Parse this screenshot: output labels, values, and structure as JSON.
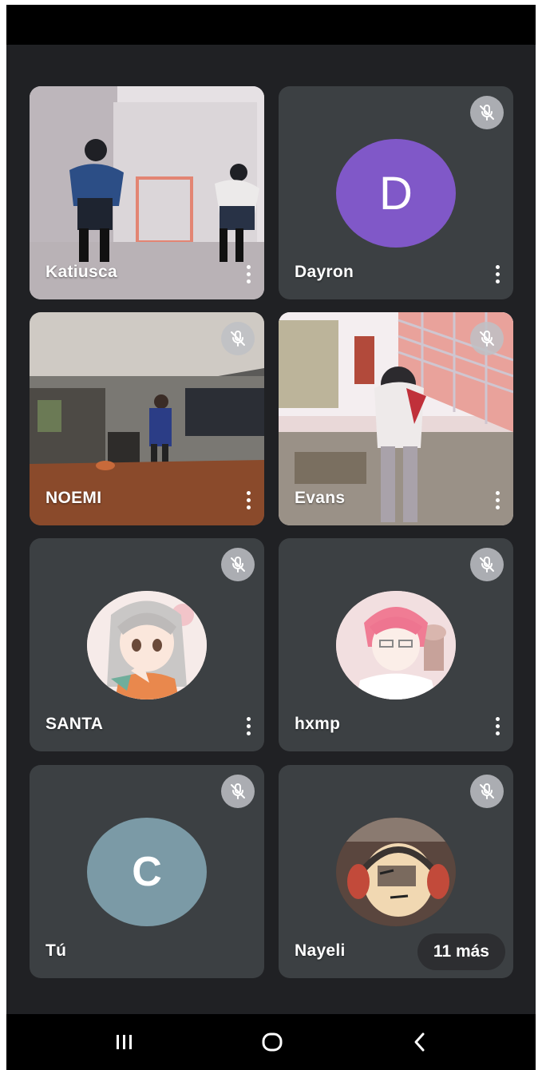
{
  "app": "Google Meet",
  "colors": {
    "background": "#202124",
    "tile": "#3c4043",
    "avatar_d": "#8058c8",
    "avatar_c": "#7b9aa6"
  },
  "participants": [
    {
      "name": "Katiusca",
      "muted": false,
      "kind": "video"
    },
    {
      "name": "Dayron",
      "muted": true,
      "kind": "letter",
      "initial": "D"
    },
    {
      "name": "NOEMI",
      "muted": true,
      "kind": "video"
    },
    {
      "name": "Evans",
      "muted": true,
      "kind": "video"
    },
    {
      "name": "SANTA",
      "muted": true,
      "kind": "photo"
    },
    {
      "name": "hxmp",
      "muted": true,
      "kind": "photo"
    },
    {
      "name": "Tú",
      "muted": true,
      "kind": "letter",
      "initial": "C"
    },
    {
      "name": "Nayeli",
      "muted": true,
      "kind": "photo"
    }
  ],
  "overflow_label": "11 más",
  "navigation": {
    "recents": "recents-icon",
    "home": "home-icon",
    "back": "back-icon"
  }
}
